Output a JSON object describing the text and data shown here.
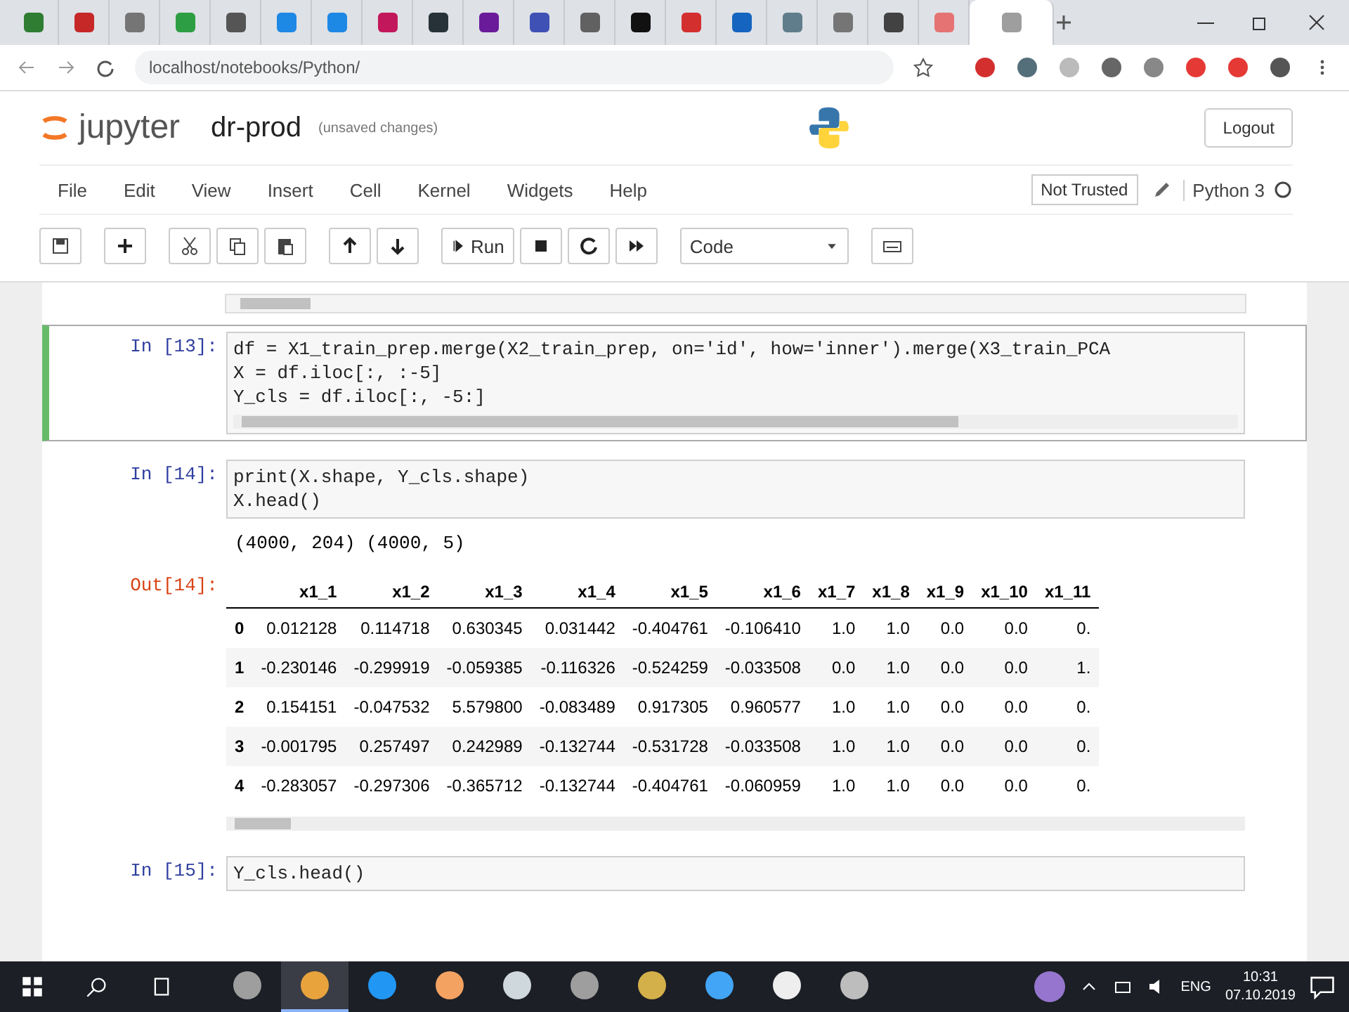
{
  "browser_tabs": [
    {
      "color": "#2e7d32",
      "selected": false
    },
    {
      "color": "#c62828",
      "selected": false
    },
    {
      "color": "#757575",
      "selected": false
    },
    {
      "color": "#2e9e44",
      "selected": false
    },
    {
      "color": "#555555",
      "selected": false
    },
    {
      "color": "#1e88e5",
      "selected": false
    },
    {
      "color": "#1e88e5",
      "selected": false
    },
    {
      "color": "#c2185b",
      "selected": false
    },
    {
      "color": "#263238",
      "selected": false
    },
    {
      "color": "#6a1b9a",
      "selected": false
    },
    {
      "color": "#3f51b5",
      "selected": false
    },
    {
      "color": "#616161",
      "selected": false
    },
    {
      "color": "#111111",
      "selected": false
    },
    {
      "color": "#d32f2f",
      "selected": false
    },
    {
      "color": "#1565c0",
      "selected": false
    },
    {
      "color": "#607d8b",
      "selected": false
    },
    {
      "color": "#757575",
      "selected": false
    },
    {
      "color": "#424242",
      "selected": false
    },
    {
      "color": "#e57373",
      "selected": false
    },
    {
      "color": "#9e9e9e",
      "selected": true
    }
  ],
  "address_bar": {
    "url": "localhost/notebooks/Python/"
  },
  "header": {
    "logo": "jupyter",
    "notebook_name": "dr-prod",
    "save_status": "(unsaved changes)",
    "logout": "Logout"
  },
  "menu": [
    "File",
    "Edit",
    "View",
    "Insert",
    "Cell",
    "Kernel",
    "Widgets",
    "Help"
  ],
  "trust_status": "Not Trusted",
  "kernel_name": "Python 3",
  "toolbar": {
    "run_label": "Run",
    "cell_type": "Code"
  },
  "cells": [
    {
      "prompt": "In [13]:",
      "selected": true,
      "lines": [
        "df = X1_train_prep.merge(X2_train_prep, on='id', how='inner').merge(X3_train_PCA",
        "X = df.iloc[:, :-5]",
        "Y_cls = df.iloc[:, -5:]"
      ]
    },
    {
      "prompt": "In [14]:",
      "selected": false,
      "lines": [
        "print(X.shape, Y_cls.shape)",
        "X.head()"
      ],
      "outputs": [
        {
          "kind": "stream",
          "text": "(4000, 204) (4000, 5)"
        },
        {
          "kind": "dataframe",
          "prompt": "Out[14]:",
          "columns": [
            "",
            "x1_1",
            "x1_2",
            "x1_3",
            "x1_4",
            "x1_5",
            "x1_6",
            "x1_7",
            "x1_8",
            "x1_9",
            "x1_10",
            "x1_11"
          ],
          "rows": [
            [
              "0",
              "0.012128",
              "0.114718",
              "0.630345",
              "0.031442",
              "-0.404761",
              "-0.106410",
              "1.0",
              "1.0",
              "0.0",
              "0.0",
              "0."
            ],
            [
              "1",
              "-0.230146",
              "-0.299919",
              "-0.059385",
              "-0.116326",
              "-0.524259",
              "-0.033508",
              "0.0",
              "1.0",
              "0.0",
              "0.0",
              "1."
            ],
            [
              "2",
              "0.154151",
              "-0.047532",
              "5.579800",
              "-0.083489",
              "0.917305",
              "0.960577",
              "1.0",
              "1.0",
              "0.0",
              "0.0",
              "0."
            ],
            [
              "3",
              "-0.001795",
              "0.257497",
              "0.242989",
              "-0.132744",
              "-0.531728",
              "-0.033508",
              "1.0",
              "1.0",
              "0.0",
              "0.0",
              "0."
            ],
            [
              "4",
              "-0.283057",
              "-0.297306",
              "-0.365712",
              "-0.132744",
              "-0.404761",
              "-0.060959",
              "1.0",
              "1.0",
              "0.0",
              "0.0",
              "0."
            ]
          ]
        }
      ]
    },
    {
      "prompt": "In [15]:",
      "selected": false,
      "lines": [
        "Y_cls.head()"
      ]
    }
  ],
  "taskbar_apps": [
    {
      "selected": false
    },
    {
      "selected": true
    },
    {
      "selected": false
    },
    {
      "selected": false
    },
    {
      "selected": false
    },
    {
      "selected": false
    },
    {
      "selected": false
    },
    {
      "selected": false
    },
    {
      "selected": false
    },
    {
      "selected": false
    }
  ],
  "tray": {
    "language": "ENG",
    "time": "10:31",
    "date": "07.10.2019"
  }
}
